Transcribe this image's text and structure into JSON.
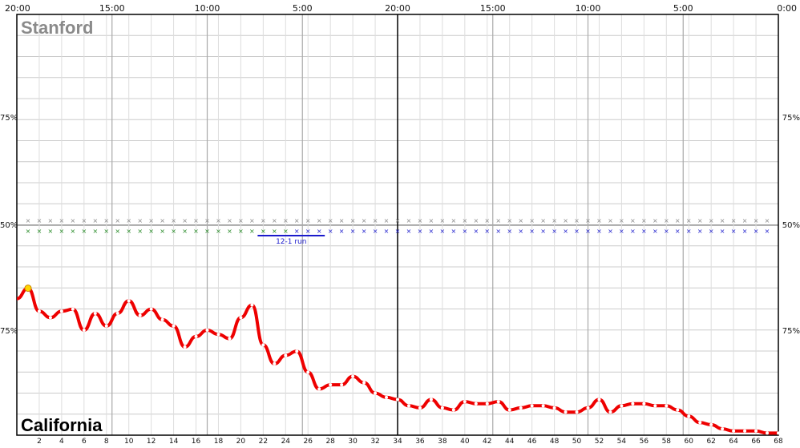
{
  "chart_data": {
    "type": "line",
    "teams": {
      "top": "Stanford",
      "bottom": "California"
    },
    "time_labels": [
      "20:00",
      "15:00",
      "10:00",
      "5:00",
      "20:00",
      "15:00",
      "10:00",
      "5:00",
      "0:00"
    ],
    "pct_labels_left": [
      "75%",
      "50%",
      "75%"
    ],
    "pct_labels_right": [
      "75%",
      "50%",
      "75%"
    ],
    "possession_labels": [
      "2",
      "4",
      "6",
      "8",
      "10",
      "12",
      "14",
      "16",
      "18",
      "20",
      "22",
      "24",
      "26",
      "28",
      "30",
      "32",
      "34",
      "36",
      "38",
      "40",
      "42",
      "44",
      "46",
      "48",
      "50",
      "52",
      "54",
      "56",
      "58",
      "60",
      "62",
      "64",
      "66",
      "68"
    ],
    "ylim": [
      -1,
      1
    ],
    "x": [
      0,
      1,
      2,
      3,
      4,
      5,
      6,
      7,
      8,
      9,
      10,
      11,
      12,
      13,
      14,
      15,
      16,
      17,
      18,
      19,
      20,
      21,
      22,
      23,
      24,
      25,
      26,
      27,
      28,
      29,
      30,
      31,
      32,
      33,
      34,
      35,
      36,
      37,
      38,
      39,
      40,
      41,
      42,
      43,
      44,
      45,
      46,
      47,
      48,
      49,
      50,
      51,
      52,
      53,
      54,
      55,
      56,
      57,
      58,
      59,
      60,
      61,
      62,
      63,
      64,
      65,
      66,
      67,
      68
    ],
    "values": [
      -0.35,
      -0.3,
      -0.41,
      -0.44,
      -0.41,
      -0.4,
      -0.5,
      -0.42,
      -0.48,
      -0.42,
      -0.36,
      -0.43,
      -0.4,
      -0.45,
      -0.48,
      -0.58,
      -0.53,
      -0.5,
      -0.52,
      -0.54,
      -0.44,
      -0.38,
      -0.57,
      -0.66,
      -0.62,
      -0.6,
      -0.7,
      -0.78,
      -0.76,
      -0.76,
      -0.72,
      -0.75,
      -0.8,
      -0.82,
      -0.83,
      -0.86,
      -0.87,
      -0.83,
      -0.87,
      -0.88,
      -0.84,
      -0.85,
      -0.85,
      -0.84,
      -0.88,
      -0.87,
      -0.86,
      -0.86,
      -0.87,
      -0.89,
      -0.89,
      -0.87,
      -0.83,
      -0.89,
      -0.86,
      -0.85,
      -0.85,
      -0.86,
      -0.86,
      -0.88,
      -0.91,
      -0.94,
      -0.95,
      -0.97,
      -0.98,
      -0.98,
      -0.98,
      -0.99,
      -0.99
    ],
    "runs": [
      {
        "label": "12-1 run"
      }
    ],
    "colors": {
      "line": "#ee0000",
      "marker_fill": "#ffffff",
      "start_marker": "#ffd400",
      "top_team_row": "#888888",
      "bottom_team_row_1": "#228822",
      "bottom_team_row_2": "#1a1acc",
      "grid": "#bbbbbb"
    }
  }
}
